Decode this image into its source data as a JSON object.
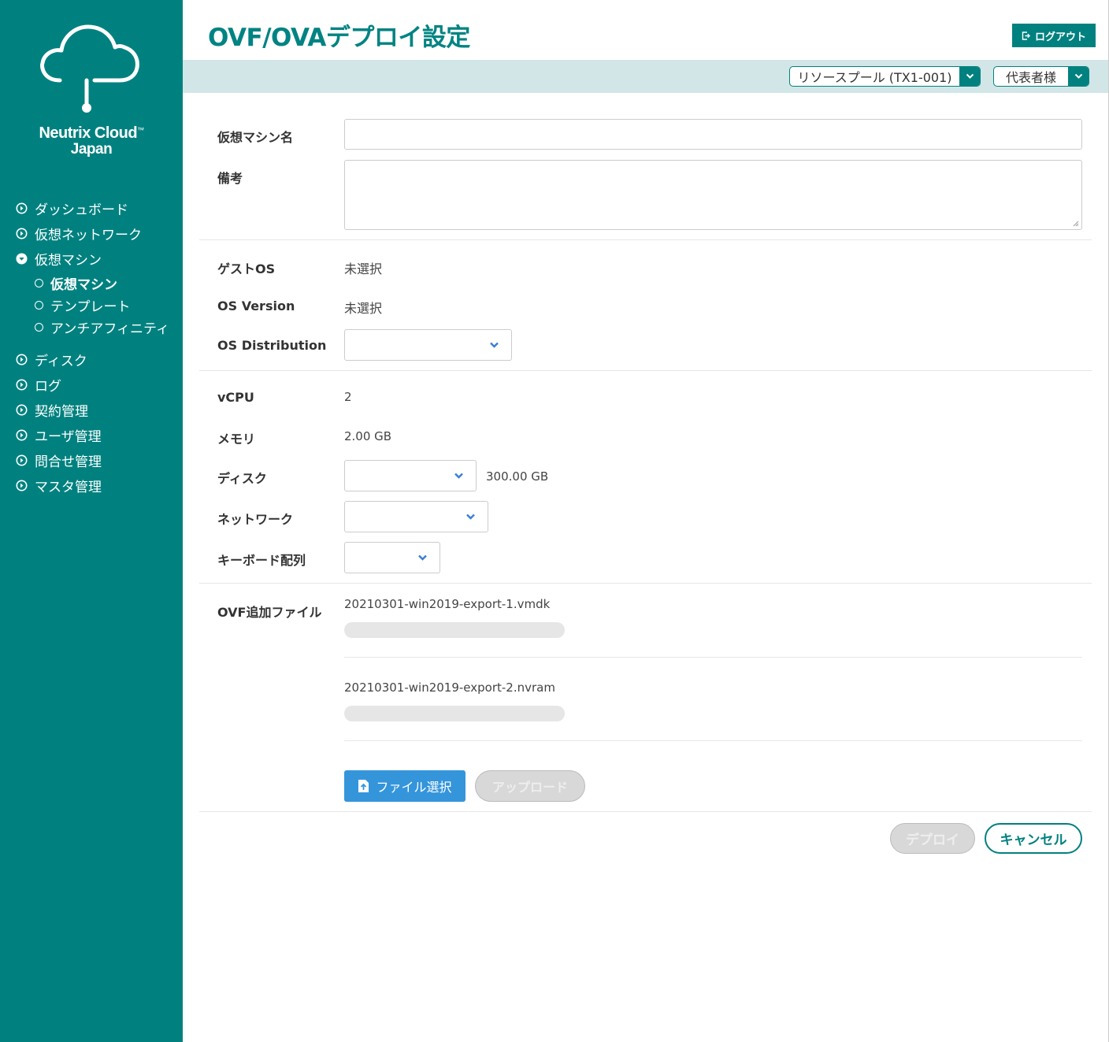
{
  "app": {
    "brand_line1": "Neutrix Cloud",
    "brand_tm": "™",
    "brand_line2": "Japan"
  },
  "nav": {
    "items": [
      {
        "label": "ダッシュボード",
        "icon": "circle-arrow-right-icon"
      },
      {
        "label": "仮想ネットワーク",
        "icon": "circle-arrow-right-icon"
      },
      {
        "label": "仮想マシン",
        "icon": "circle-arrow-down-icon",
        "expanded": true
      },
      {
        "label": "ディスク",
        "icon": "circle-arrow-right-icon"
      },
      {
        "label": "ログ",
        "icon": "circle-arrow-right-icon"
      },
      {
        "label": "契約管理",
        "icon": "circle-arrow-right-icon"
      },
      {
        "label": "ユーザ管理",
        "icon": "circle-arrow-right-icon"
      },
      {
        "label": "問合せ管理",
        "icon": "circle-arrow-right-icon"
      },
      {
        "label": "マスタ管理",
        "icon": "circle-arrow-right-icon"
      }
    ],
    "subitems": [
      {
        "label": "仮想マシン",
        "active": true
      },
      {
        "label": "テンプレート",
        "active": false
      },
      {
        "label": "アンチアフィニティ",
        "active": false
      }
    ]
  },
  "header": {
    "title": "OVF/OVAデプロイ設定",
    "logout_label": "ログアウト",
    "resource_pool": "リソースプール (TX1-001)",
    "user": "代表者様"
  },
  "form": {
    "vm_name_label": "仮想マシン名",
    "vm_name_value": "",
    "note_label": "備考",
    "note_value": "",
    "guest_os_label": "ゲストOS",
    "guest_os_value": "未選択",
    "os_version_label": "OS Version",
    "os_version_value": "未選択",
    "os_distribution_label": "OS Distribution",
    "os_distribution_value": "",
    "vcpu_label": "vCPU",
    "vcpu_value": "2",
    "memory_label": "メモリ",
    "memory_value": "2.00 GB",
    "disk_label": "ディスク",
    "disk_value": "",
    "disk_size": "300.00 GB",
    "network_label": "ネットワーク",
    "network_value": "",
    "keyboard_label": "キーボード配列",
    "keyboard_value": "",
    "ovf_files_label": "OVF追加ファイル",
    "files": [
      {
        "name": "20210301-win2019-export-1.vmdk",
        "progress": 0
      },
      {
        "name": "20210301-win2019-export-2.nvram",
        "progress": 0
      }
    ],
    "file_select_label": "ファイル選択",
    "upload_label": "アップロード",
    "deploy_label": "デプロイ",
    "cancel_label": "キャンセル"
  },
  "colors": {
    "brand": "#00817f",
    "subbar": "#d2e6e7",
    "file_button": "#3595db",
    "chevron": "#3a7fd6"
  }
}
